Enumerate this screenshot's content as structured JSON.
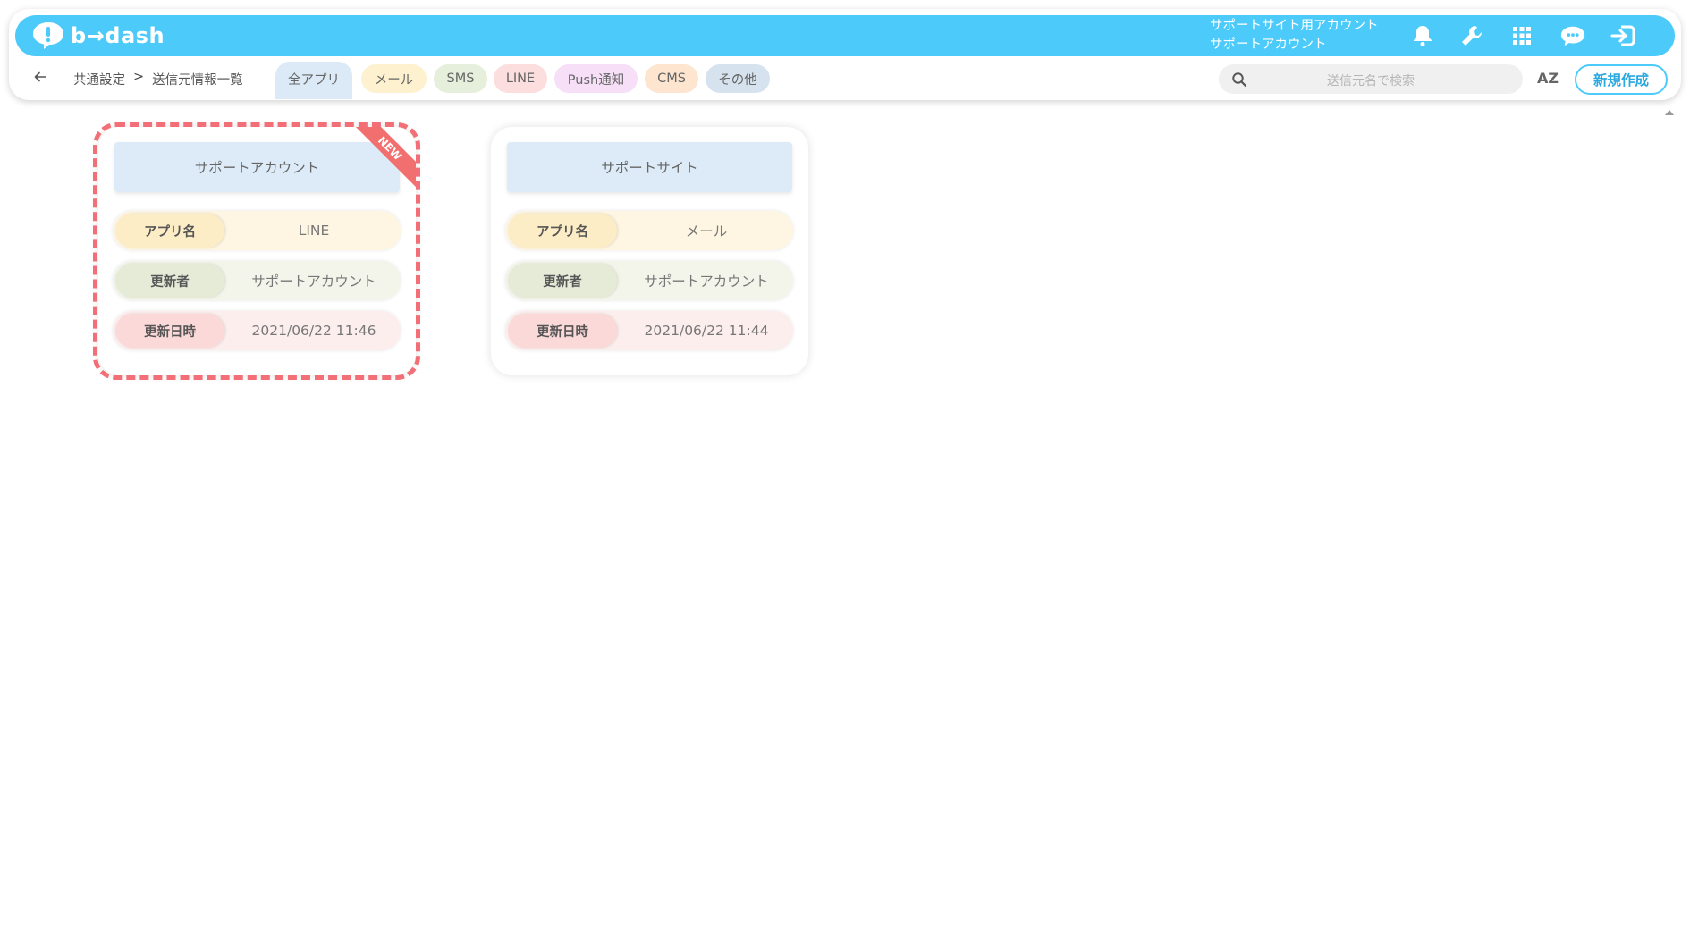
{
  "header": {
    "logo_text": "b→dash",
    "user_account_line": "サポートサイト用アカウント",
    "user_name_line": "サポートアカウント",
    "icons": [
      "bell-icon",
      "wrench-icon",
      "apps-grid-icon",
      "support-chat-icon",
      "logout-icon"
    ]
  },
  "breadcrumb": {
    "back_icon": "arrow-left-icon",
    "items": [
      "共通設定",
      "送信元情報一覧"
    ],
    "separator": ">"
  },
  "filters": {
    "chips": [
      {
        "label": "全アプリ",
        "color": "#dbeaf6",
        "active": true
      },
      {
        "label": "メール",
        "color": "#fdf1cf",
        "active": false
      },
      {
        "label": "SMS",
        "color": "#e6efdb",
        "active": false
      },
      {
        "label": "LINE",
        "color": "#fcdede",
        "active": false
      },
      {
        "label": "Push通知",
        "color": "#f6dff7",
        "active": false
      },
      {
        "label": "CMS",
        "color": "#fde5cf",
        "active": false
      },
      {
        "label": "その他",
        "color": "#d6e3ef",
        "active": false
      }
    ]
  },
  "search": {
    "placeholder": "送信元名で検索",
    "icon": "search-icon"
  },
  "sort": {
    "label": "AZ"
  },
  "new_button": {
    "label": "新規作成",
    "color": "#4ccbfb"
  },
  "cards": [
    {
      "title": "サポートアカウント",
      "badge": "NEW",
      "highlighted": true,
      "rows": [
        {
          "label": "アプリ名",
          "value": "LINE"
        },
        {
          "label": "更新者",
          "value": "サポートアカウント"
        },
        {
          "label": "更新日時",
          "value": "2021/06/22 11:46"
        }
      ]
    },
    {
      "title": "サポートサイト",
      "badge": "",
      "highlighted": false,
      "rows": [
        {
          "label": "アプリ名",
          "value": "メール"
        },
        {
          "label": "更新者",
          "value": "サポートアカウント"
        },
        {
          "label": "更新日時",
          "value": "2021/06/22 11:44"
        }
      ]
    }
  ],
  "colors": {
    "brand": "#4ccbfb",
    "row_app": "#fef6e2",
    "label_app": "#fdedc6",
    "row_user": "#f3f5ea",
    "label_user": "#e6ebd8",
    "row_date": "#fdeeee",
    "label_date": "#fcd9d9",
    "highlight": "#f26f77"
  }
}
